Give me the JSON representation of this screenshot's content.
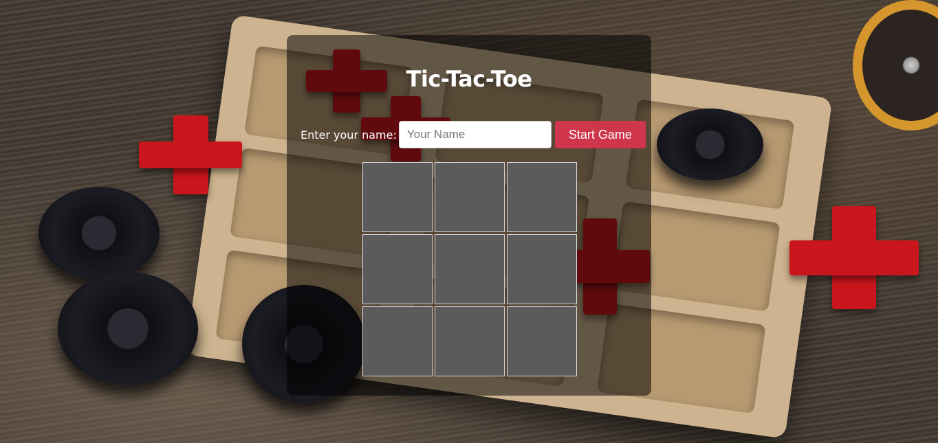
{
  "game": {
    "title": "Tic-Tac-Toe",
    "name_label": "Enter your name:",
    "name_input": {
      "placeholder": "Your Name",
      "value": ""
    },
    "start_button": "Start Game",
    "board_cells": [
      "",
      "",
      "",
      "",
      "",
      "",
      "",
      "",
      ""
    ]
  },
  "colors": {
    "panel_overlay": "rgba(0,0,0,0.52)",
    "start_button": "#d0364b",
    "cell_fill": "#5b5b5b",
    "cell_border": "#d8d8d8"
  }
}
